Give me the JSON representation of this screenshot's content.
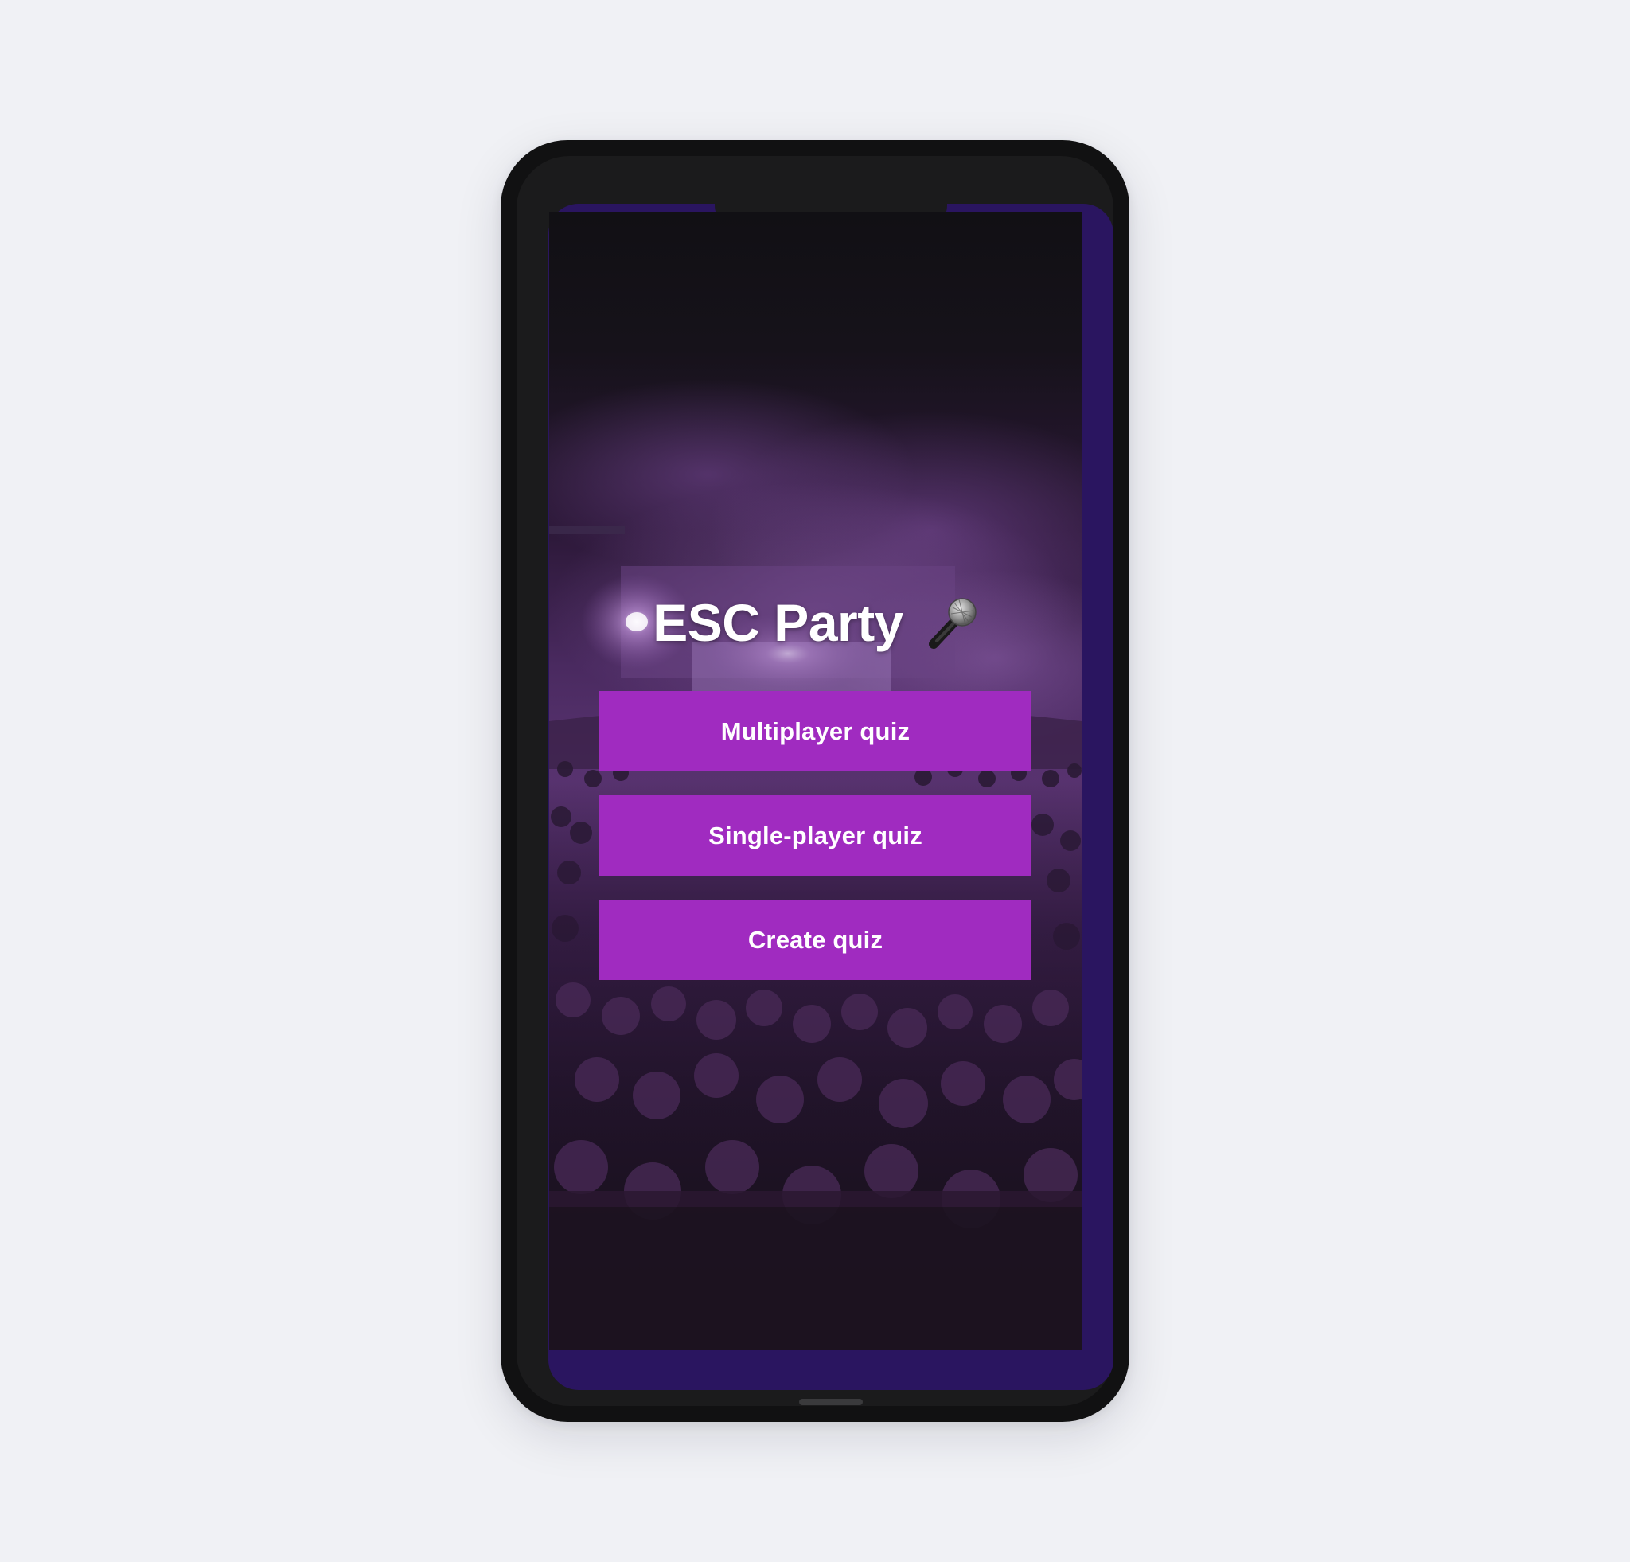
{
  "app": {
    "title": "ESC Party",
    "title_icon": "microphone-icon"
  },
  "menu": {
    "buttons": [
      {
        "label": "Multiplayer quiz"
      },
      {
        "label": "Single-player quiz"
      },
      {
        "label": "Create quiz"
      }
    ]
  },
  "colors": {
    "page_background": "#f0f1f5",
    "phone_body": "#111112",
    "screen_frame": "#2a1560",
    "button": "#a02bc0",
    "button_text": "#ffffff",
    "title_text": "#ffffff"
  },
  "background_image": "concert-crowd-purple-stage"
}
